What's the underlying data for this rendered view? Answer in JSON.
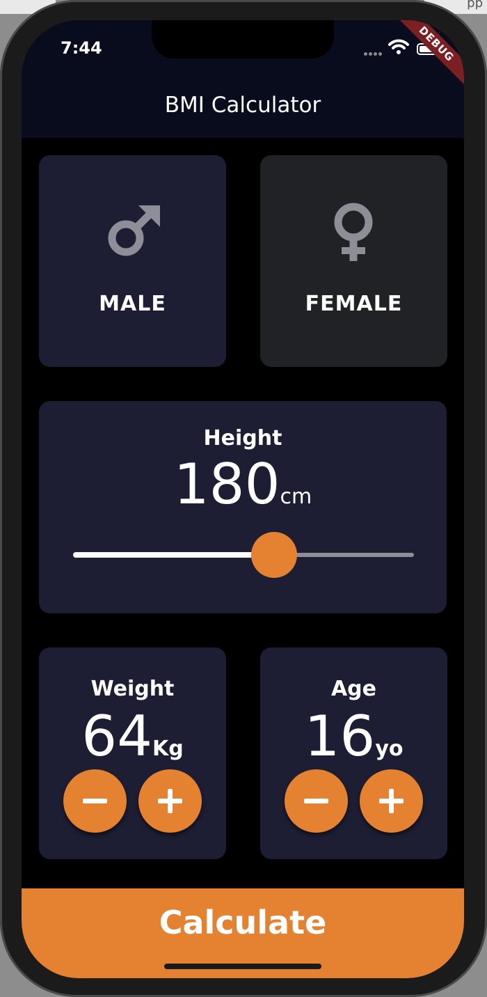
{
  "status_bar": {
    "time": "7:44",
    "icons": [
      "cellular-dots-icon",
      "wifi-icon",
      "battery-icon"
    ]
  },
  "debug_banner": "DEBUG",
  "app_bar": {
    "title": "BMI Calculator"
  },
  "gender": {
    "selected": "male",
    "male": {
      "label": "MALE",
      "icon": "mars-icon"
    },
    "female": {
      "label": "FEMALE",
      "icon": "venus-icon"
    }
  },
  "height": {
    "label": "Height",
    "value": "180",
    "unit": "cm",
    "slider_fraction": 0.59
  },
  "weight": {
    "label": "Weight",
    "value": "64",
    "unit": "Kg"
  },
  "age": {
    "label": "Age",
    "value": "16",
    "unit": "yo"
  },
  "calculate": {
    "label": "Calculate"
  },
  "colors": {
    "accent": "#e58232",
    "active_card": "#1d1e33",
    "inactive_card": "#212226",
    "app_bar": "#090c1d",
    "icon_gray": "#8d8e98"
  }
}
